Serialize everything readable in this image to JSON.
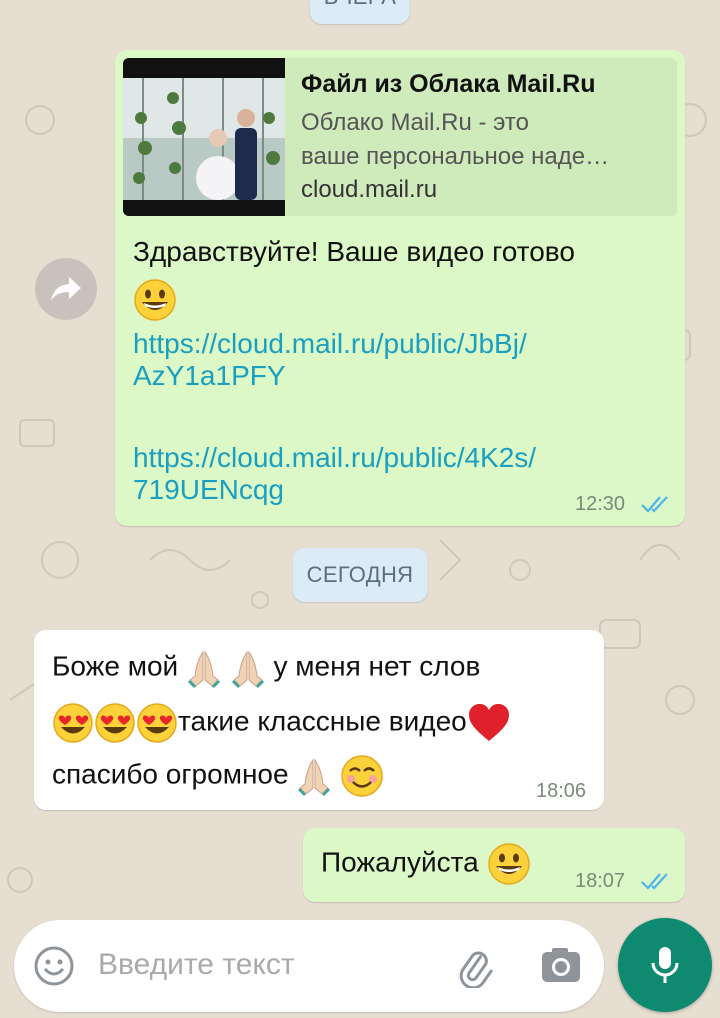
{
  "colors": {
    "outgoing_bubble": "#dcf8c6",
    "incoming_bubble": "#ffffff",
    "link": "#1a9fc0",
    "read_ticks": "#4fb6ec",
    "mic_button": "#0d8a6f"
  },
  "chips": {
    "yesterday": "ВЧЕРА",
    "today": "СЕГОДНЯ"
  },
  "messages": [
    {
      "direction": "outgoing",
      "preview": {
        "title": "Файл из Облака Mail.Ru",
        "description_line1": "Облако Mail.Ru - это",
        "description_line2": "ваше персональное наде…",
        "domain": "cloud.mail.ru"
      },
      "text_line1": "Здравствуйте!  Ваше видео готово",
      "link1_line1": "https://cloud.mail.ru/public/JbBj/",
      "link1_line2": "AzY1a1PFY",
      "link2_line1": "https://cloud.mail.ru/public/4K2s/",
      "link2_line2": "719UENcqg",
      "time": "12:30",
      "status_icon": "double-check-read-icon"
    },
    {
      "direction": "incoming",
      "line1": "Боже мой",
      "line1_tail": "у меня нет слов",
      "line2": "такие классные видео",
      "line3": "спасибо огромное",
      "time": "18:06"
    },
    {
      "direction": "outgoing",
      "text": "Пожалуйста",
      "time": "18:07",
      "status_icon": "double-check-read-icon"
    }
  ],
  "composer": {
    "placeholder": "Введите текст",
    "icons": [
      "emoji-icon",
      "paperclip-icon",
      "camera-icon",
      "microphone-icon"
    ]
  },
  "side_icons": [
    "forward-icon"
  ]
}
